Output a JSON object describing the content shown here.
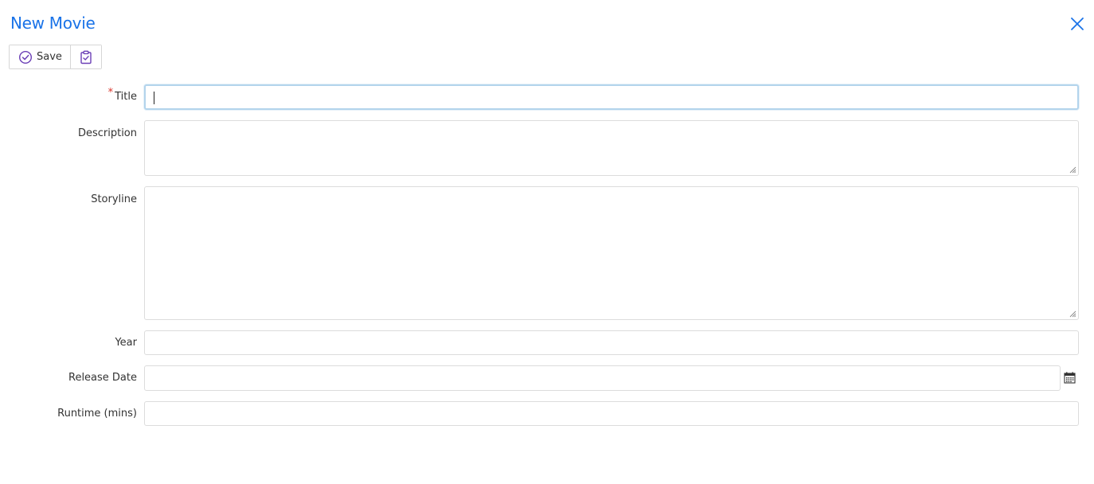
{
  "dialog": {
    "title": "New Movie",
    "close_icon": "close-icon"
  },
  "toolbar": {
    "save_label": "Save",
    "save_icon": "check-circle-icon",
    "validate_icon": "clipboard-check-icon"
  },
  "form": {
    "title": {
      "label": "Title",
      "required_marker": "*",
      "value": ""
    },
    "description": {
      "label": "Description",
      "value": ""
    },
    "storyline": {
      "label": "Storyline",
      "value": ""
    },
    "year": {
      "label": "Year",
      "value": ""
    },
    "release_date": {
      "label": "Release Date",
      "value": "",
      "picker_icon": "calendar-icon"
    },
    "runtime": {
      "label": "Runtime (mins)",
      "value": ""
    }
  },
  "colors": {
    "accent": "#1a73e8",
    "icon_purple": "#6b3fb6",
    "required": "#d9342b",
    "border": "#dcdcdc",
    "focus_border": "#b3d4ec"
  }
}
